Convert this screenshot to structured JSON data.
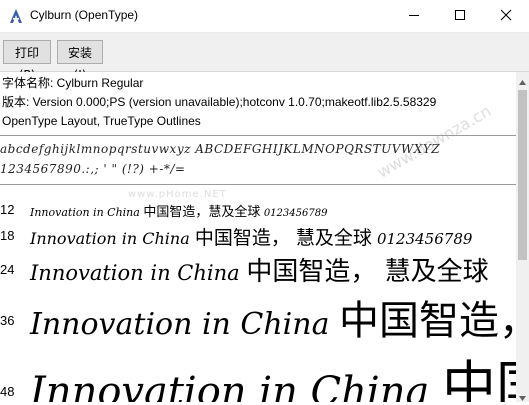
{
  "window": {
    "title": "Cylburn (OpenType)",
    "colors": {
      "titlebar": "#ffffff",
      "toolbar": "#f0f0f0",
      "button_face": "#e1e1e1",
      "icon_accent": "#3a5ea8"
    }
  },
  "toolbar": {
    "print_label": "打印(P)",
    "install_label": "安装(I)"
  },
  "info": {
    "font_name": "字体名称: Cylburn Regular",
    "version": "版本: Version 0.000;PS (version unavailable);hotconv 1.0.70;makeotf.lib2.5.58329",
    "outline": "OpenType Layout, TrueType Outlines"
  },
  "charset": {
    "line1": "abcdefghijklmnopqrstuvwxyz  ABCDEFGHIJKLMNOPQRSTUVWXYZ",
    "line2": "1234567890.:,; ' \" (!?) +-*/="
  },
  "samples": [
    {
      "size": "12",
      "latin": "Innovation in China",
      "cjk": "中国智造，慧及全球",
      "digits": "0123456789"
    },
    {
      "size": "18",
      "latin": "Innovation in China",
      "cjk": "中国智造， 慧及全球",
      "digits": "0123456789"
    },
    {
      "size": "24",
      "latin": "Innovation in China",
      "cjk": "中国智造， 慧及全球",
      "digits": ""
    },
    {
      "size": "36",
      "latin": "Innovation in China",
      "cjk": "中国智造，",
      "digits": ""
    },
    {
      "size": "48",
      "latin": "Innovation in China",
      "cjk": "中国",
      "digits": ""
    }
  ],
  "watermark": {
    "text1": "www.pHome.NET",
    "text2": "www.downza.cn"
  }
}
